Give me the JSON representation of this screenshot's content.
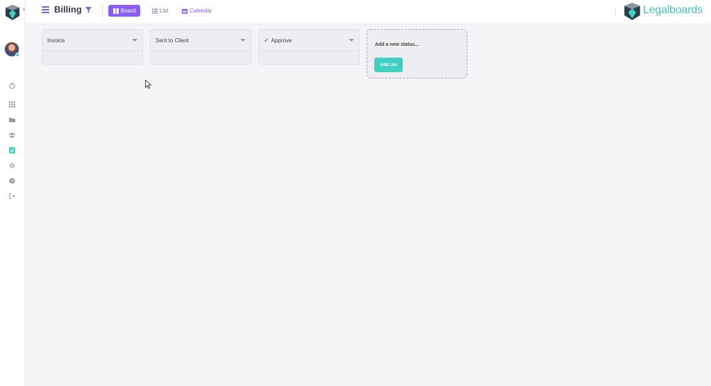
{
  "header": {
    "title": "Billing",
    "views": [
      {
        "label": "Board",
        "active": true
      },
      {
        "label": "List",
        "active": false
      },
      {
        "label": "Calendar",
        "active": false
      }
    ]
  },
  "brand": {
    "name": "Legalboards"
  },
  "sidebar": {
    "items": [
      "timer-icon",
      "apps-icon",
      "folder-icon",
      "team-icon",
      "tasks-icon",
      "settings-icon",
      "help-icon",
      "logout-icon"
    ]
  },
  "board": {
    "columns": [
      {
        "name": "Invoice",
        "checked": false
      },
      {
        "name": "Sent to Client",
        "checked": false
      },
      {
        "name": "Approve",
        "checked": true
      }
    ],
    "new_status": {
      "placeholder": "Add a new status...",
      "button_label": "Add List"
    }
  },
  "colors": {
    "accent": "#8b5cf6",
    "teal": "#3fd1c3",
    "background": "#f4f4f7"
  }
}
